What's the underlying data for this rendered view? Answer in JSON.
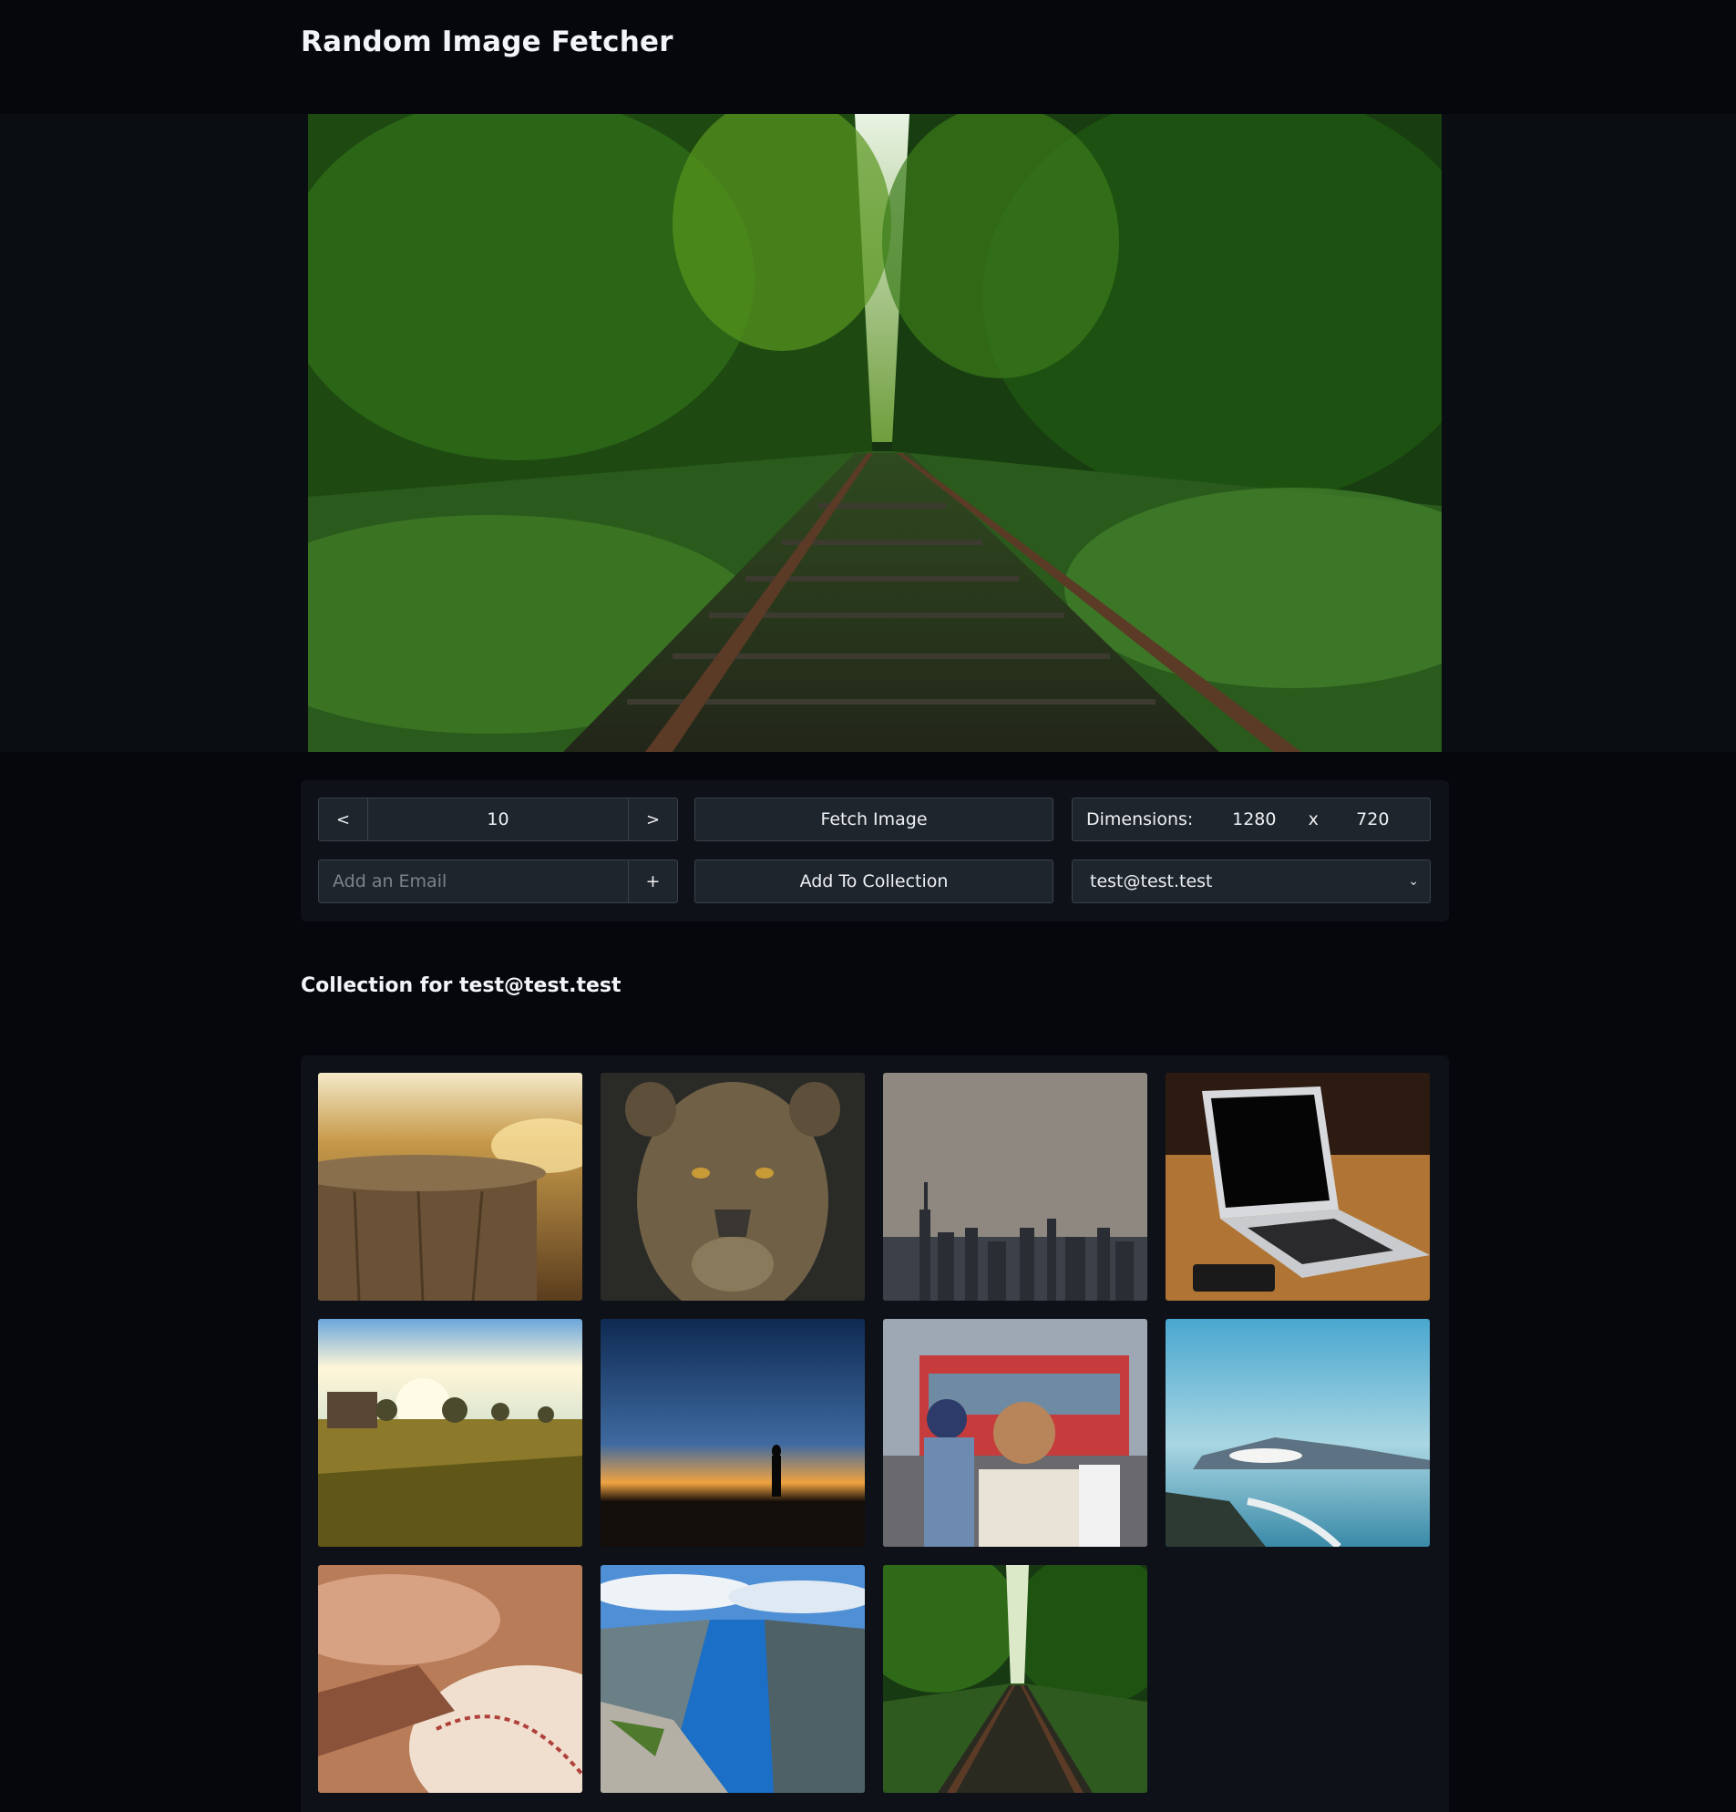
{
  "app": {
    "title": "Random Image Fetcher"
  },
  "controls": {
    "prev_label": "<",
    "next_label": ">",
    "index_value": "10",
    "fetch_label": "Fetch Image",
    "dimensions_label": "Dimensions:",
    "width_value": "1280",
    "times_sign": "x",
    "height_value": "720",
    "email_placeholder": "Add an Email",
    "add_email_label": "+",
    "add_to_collection_label": "Add To Collection",
    "selected_email": "test@test.test"
  },
  "collection": {
    "title": "Collection for test@test.test",
    "images": [
      {
        "name": "tree-stump-sunset"
      },
      {
        "name": "lioness-portrait"
      },
      {
        "name": "hazy-city-skyline"
      },
      {
        "name": "laptop-on-desk"
      },
      {
        "name": "sunny-orchard-field"
      },
      {
        "name": "silhouette-at-dusk"
      },
      {
        "name": "street-traffic-traveler"
      },
      {
        "name": "coastline-aerial"
      },
      {
        "name": "baseball-in-glove"
      },
      {
        "name": "fjord-from-cliff"
      },
      {
        "name": "overgrown-railway"
      }
    ]
  },
  "colors": {
    "page_bg": "#05070d",
    "panel_bg": "#0e1218",
    "control_bg": "#1f252d",
    "control_border": "#3a414b"
  }
}
